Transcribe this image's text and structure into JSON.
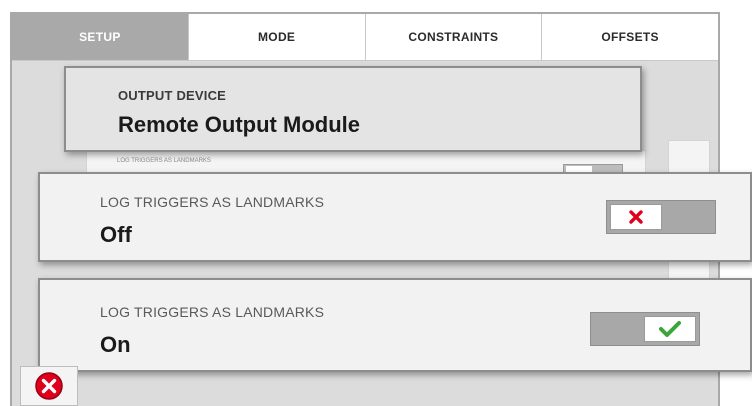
{
  "tabs": [
    {
      "label": "SETUP",
      "active": true
    },
    {
      "label": "MODE",
      "active": false
    },
    {
      "label": "CONSTRAINTS",
      "active": false
    },
    {
      "label": "OFFSETS",
      "active": false
    }
  ],
  "output_card": {
    "label": "OUTPUT DEVICE",
    "value": "Remote Output Module"
  },
  "background_row": {
    "label": "LOG TRIGGERS AS LANDMARKS"
  },
  "log_triggers_off": {
    "label": "LOG TRIGGERS AS LANDMARKS",
    "value": "Off",
    "toggle_state": "off",
    "icon": "x-icon"
  },
  "log_triggers_on": {
    "label": "LOG TRIGGERS AS LANDMARKS",
    "value": "On",
    "toggle_state": "on",
    "icon": "checkmark-icon"
  },
  "colors": {
    "active_tab_bg": "#a9a9a9",
    "x_red": "#e0001b",
    "check_green": "#3aa63a"
  }
}
